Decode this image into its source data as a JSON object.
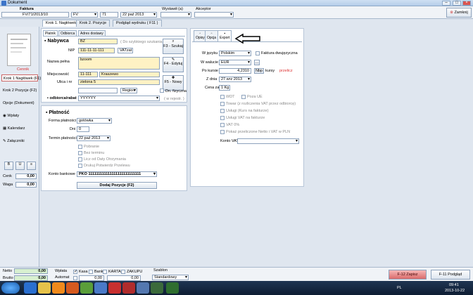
{
  "window": {
    "title": "Dokument"
  },
  "toolbar": {
    "faktura_label": "Faktura",
    "doc_number": "FV/71/2013/10",
    "doc_type": "FV",
    "number": "71",
    "date": "22 paź 2013",
    "wystawil_label": "Wystawił (a)",
    "akceptor_label": "Akceptor",
    "close_label": "Zamknij"
  },
  "tabs": [
    "Krok 1. Nagłówek",
    "Krok 2. Pozycje",
    "Podgląd wydruku ( F11 )"
  ],
  "left_nav": {
    "doc_label": "Cennik",
    "items": [
      "Krok 1 Nagłówek (F1)",
      "Krok 2 Pozycje (F2)",
      "Opcje (Dokument)"
    ],
    "tools": [
      "Wpłaty",
      "Kalendarz",
      "Załączniki"
    ],
    "cenk_label": "Cenk",
    "cenk_value": "0,00",
    "waga_label": "Waga",
    "waga_value": "0,00"
  },
  "client_panel": {
    "tabs": [
      "Płatnik",
      "Odbiorca",
      "Adres dostawy"
    ],
    "heading": "Nabywca",
    "code": "BZ",
    "search_hint": "( Do szybkiego szukania )",
    "nip_label": "NIP",
    "nip_value": "111-11-11-111",
    "vat_value": "VATzat",
    "f3_label": "F3 - Szukaj",
    "name_label": "Nazwa pełna",
    "name_value": "bzoom",
    "f4_label": "F4 - Edytuj",
    "city_label": "Miejscowość",
    "postcode": "11-111",
    "city": "Kraszewo",
    "street_label": "Ulica i nr",
    "street": "zielona 5",
    "f5_label": "F5 - Nowy",
    "region_label": "Region",
    "on_request_label": "Dn. fizyczna",
    "receiver_label": "odbiorca/rabat",
    "receiver_value": "YYYYYY",
    "register_label": "( w rejestr. )"
  },
  "payment_panel": {
    "heading": "Płatność",
    "form_label": "Forma płatności",
    "form_value": "gotówka",
    "days_label": "Dni",
    "days_value": "0",
    "term_label": "Termin płatności",
    "term_value": "22 paź 2013",
    "options": [
      "Pobranie",
      "Bez terminu",
      "Licz od Daty Otrzymania",
      "Drukuj Potwierdz Przelewu"
    ],
    "bank_label": "Konto bankowe",
    "bank_value": "PKO 111111111111111111111111111",
    "add_button": "Dodaj Pozycje (F2)"
  },
  "export_panel": {
    "tabs": [
      "Opisy",
      "Opcja",
      "Export"
    ],
    "lang_label": "W języku",
    "lang_value": "Polskim",
    "dual_label": "Faktura dwujęzyczna",
    "currency_label": "W walucie",
    "currency_value": "EUR",
    "rate_label": "Po kursie",
    "rate_value": "4,2310",
    "nbp_label": "Nbp",
    "kursy_label": "kursy",
    "przelicz_label": "przelicz",
    "date_label": "Z dnia",
    "date_value": "27 wrz 2013",
    "price_label": "Cena za",
    "price_value": "1 Kg",
    "wdt_label": "WDT",
    "poza_label": "Poza UE",
    "opts": [
      "Towar (z rozliczenia VAT przez odbiorcę)",
      "Usługi (Kurs na fakturze)",
      "Usługi VAT na fakturze",
      "VAT 0%",
      "Pokaż przeliczone Netto i VAT w PLN"
    ],
    "konto_label": "Konto VAT"
  },
  "bottom": {
    "netto_label": "Netto",
    "netto_value": "0,00",
    "brutto_label": "Brutto",
    "brutto_value": "0,00",
    "wplata_label": "Wpłata",
    "automat_label": "Automat",
    "kasa_label": "Kasa",
    "bank_label": "Bank",
    "karta_label": "KARTA",
    "zakupu_label": "ZAKUPU",
    "wplata_value": "0,00",
    "szablon_label": "Szablon",
    "szablon_value": "Standardowy",
    "save_button": "F-12 Zapisz",
    "preview_button": "F-11 Podgląd"
  },
  "taskbar": {
    "lang": "PL",
    "time": "09:41",
    "date": "2013-10-22"
  }
}
